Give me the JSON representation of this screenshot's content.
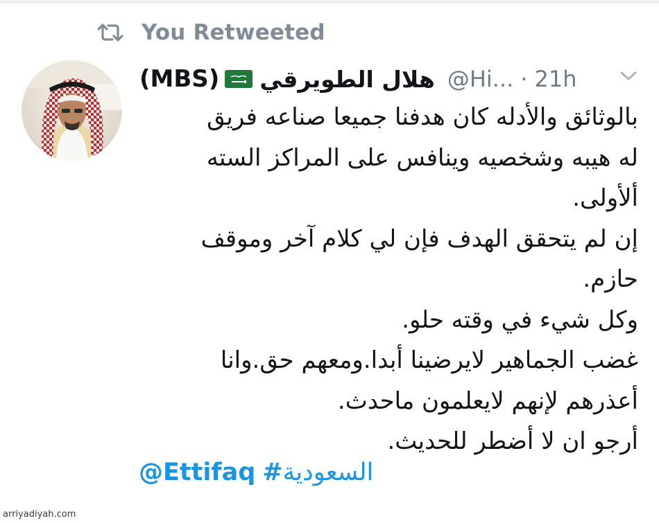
{
  "retweet": {
    "icon": "retweet-icon",
    "label": "You Retweeted"
  },
  "tweet": {
    "avatar_icon": "avatar",
    "author": {
      "name_latin": "(MBS)",
      "flag_icon": "saudi-flag-icon",
      "name_arabic": "هلال الطويرقي",
      "handle": "@Hi...",
      "separator": "·",
      "time": "21h"
    },
    "menu_icon": "chevron-down-icon",
    "lines": [
      "بالوثائق والأدله كان هدفنا جميعا صناعه فريق",
      "له هيبه وشخصيه وينافس على المراكز السته",
      "ألأولى.",
      "إن لم يتحقق الهدف فإن لي كلام آخر وموقف",
      "حازم.",
      "وكل شيء في وقته حلو.",
      "غضب الجماهير لايرضينا أبدا.ومعهم حق.وانا",
      "أعذرهم لإنهم لايعلمون ماحدث.",
      "أرجو ان لا أضطر للحديث."
    ],
    "mention": "@Ettifaq",
    "hashtag_symbol": "#",
    "hashtag_text": "السعودية"
  },
  "watermark": "arriyadiyah.com",
  "colors": {
    "link": "#1b95e0",
    "secondary_text": "#7f8c96",
    "primary_text": "#111418",
    "flag_green": "#1f7a3a"
  }
}
